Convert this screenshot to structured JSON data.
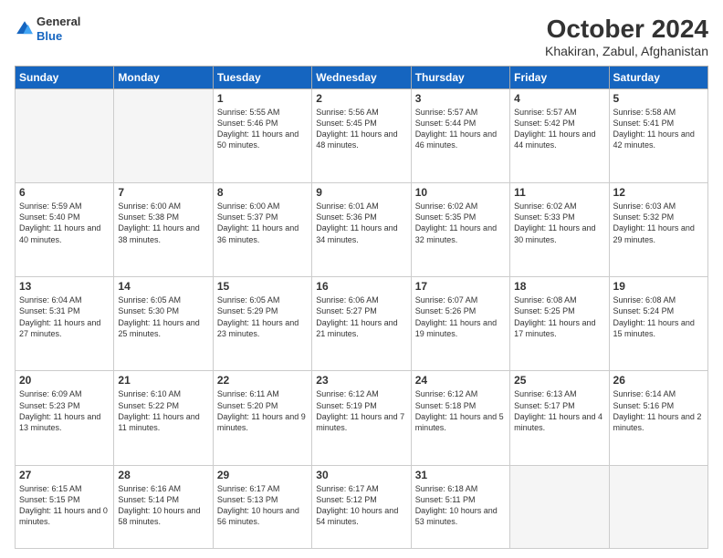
{
  "header": {
    "logo_line1": "General",
    "logo_line2": "Blue",
    "month": "October 2024",
    "location": "Khakiran, Zabul, Afghanistan"
  },
  "weekdays": [
    "Sunday",
    "Monday",
    "Tuesday",
    "Wednesday",
    "Thursday",
    "Friday",
    "Saturday"
  ],
  "weeks": [
    [
      {
        "day": "",
        "info": ""
      },
      {
        "day": "",
        "info": ""
      },
      {
        "day": "1",
        "info": "Sunrise: 5:55 AM\nSunset: 5:46 PM\nDaylight: 11 hours and 50 minutes."
      },
      {
        "day": "2",
        "info": "Sunrise: 5:56 AM\nSunset: 5:45 PM\nDaylight: 11 hours and 48 minutes."
      },
      {
        "day": "3",
        "info": "Sunrise: 5:57 AM\nSunset: 5:44 PM\nDaylight: 11 hours and 46 minutes."
      },
      {
        "day": "4",
        "info": "Sunrise: 5:57 AM\nSunset: 5:42 PM\nDaylight: 11 hours and 44 minutes."
      },
      {
        "day": "5",
        "info": "Sunrise: 5:58 AM\nSunset: 5:41 PM\nDaylight: 11 hours and 42 minutes."
      }
    ],
    [
      {
        "day": "6",
        "info": "Sunrise: 5:59 AM\nSunset: 5:40 PM\nDaylight: 11 hours and 40 minutes."
      },
      {
        "day": "7",
        "info": "Sunrise: 6:00 AM\nSunset: 5:38 PM\nDaylight: 11 hours and 38 minutes."
      },
      {
        "day": "8",
        "info": "Sunrise: 6:00 AM\nSunset: 5:37 PM\nDaylight: 11 hours and 36 minutes."
      },
      {
        "day": "9",
        "info": "Sunrise: 6:01 AM\nSunset: 5:36 PM\nDaylight: 11 hours and 34 minutes."
      },
      {
        "day": "10",
        "info": "Sunrise: 6:02 AM\nSunset: 5:35 PM\nDaylight: 11 hours and 32 minutes."
      },
      {
        "day": "11",
        "info": "Sunrise: 6:02 AM\nSunset: 5:33 PM\nDaylight: 11 hours and 30 minutes."
      },
      {
        "day": "12",
        "info": "Sunrise: 6:03 AM\nSunset: 5:32 PM\nDaylight: 11 hours and 29 minutes."
      }
    ],
    [
      {
        "day": "13",
        "info": "Sunrise: 6:04 AM\nSunset: 5:31 PM\nDaylight: 11 hours and 27 minutes."
      },
      {
        "day": "14",
        "info": "Sunrise: 6:05 AM\nSunset: 5:30 PM\nDaylight: 11 hours and 25 minutes."
      },
      {
        "day": "15",
        "info": "Sunrise: 6:05 AM\nSunset: 5:29 PM\nDaylight: 11 hours and 23 minutes."
      },
      {
        "day": "16",
        "info": "Sunrise: 6:06 AM\nSunset: 5:27 PM\nDaylight: 11 hours and 21 minutes."
      },
      {
        "day": "17",
        "info": "Sunrise: 6:07 AM\nSunset: 5:26 PM\nDaylight: 11 hours and 19 minutes."
      },
      {
        "day": "18",
        "info": "Sunrise: 6:08 AM\nSunset: 5:25 PM\nDaylight: 11 hours and 17 minutes."
      },
      {
        "day": "19",
        "info": "Sunrise: 6:08 AM\nSunset: 5:24 PM\nDaylight: 11 hours and 15 minutes."
      }
    ],
    [
      {
        "day": "20",
        "info": "Sunrise: 6:09 AM\nSunset: 5:23 PM\nDaylight: 11 hours and 13 minutes."
      },
      {
        "day": "21",
        "info": "Sunrise: 6:10 AM\nSunset: 5:22 PM\nDaylight: 11 hours and 11 minutes."
      },
      {
        "day": "22",
        "info": "Sunrise: 6:11 AM\nSunset: 5:20 PM\nDaylight: 11 hours and 9 minutes."
      },
      {
        "day": "23",
        "info": "Sunrise: 6:12 AM\nSunset: 5:19 PM\nDaylight: 11 hours and 7 minutes."
      },
      {
        "day": "24",
        "info": "Sunrise: 6:12 AM\nSunset: 5:18 PM\nDaylight: 11 hours and 5 minutes."
      },
      {
        "day": "25",
        "info": "Sunrise: 6:13 AM\nSunset: 5:17 PM\nDaylight: 11 hours and 4 minutes."
      },
      {
        "day": "26",
        "info": "Sunrise: 6:14 AM\nSunset: 5:16 PM\nDaylight: 11 hours and 2 minutes."
      }
    ],
    [
      {
        "day": "27",
        "info": "Sunrise: 6:15 AM\nSunset: 5:15 PM\nDaylight: 11 hours and 0 minutes."
      },
      {
        "day": "28",
        "info": "Sunrise: 6:16 AM\nSunset: 5:14 PM\nDaylight: 10 hours and 58 minutes."
      },
      {
        "day": "29",
        "info": "Sunrise: 6:17 AM\nSunset: 5:13 PM\nDaylight: 10 hours and 56 minutes."
      },
      {
        "day": "30",
        "info": "Sunrise: 6:17 AM\nSunset: 5:12 PM\nDaylight: 10 hours and 54 minutes."
      },
      {
        "day": "31",
        "info": "Sunrise: 6:18 AM\nSunset: 5:11 PM\nDaylight: 10 hours and 53 minutes."
      },
      {
        "day": "",
        "info": ""
      },
      {
        "day": "",
        "info": ""
      }
    ]
  ]
}
